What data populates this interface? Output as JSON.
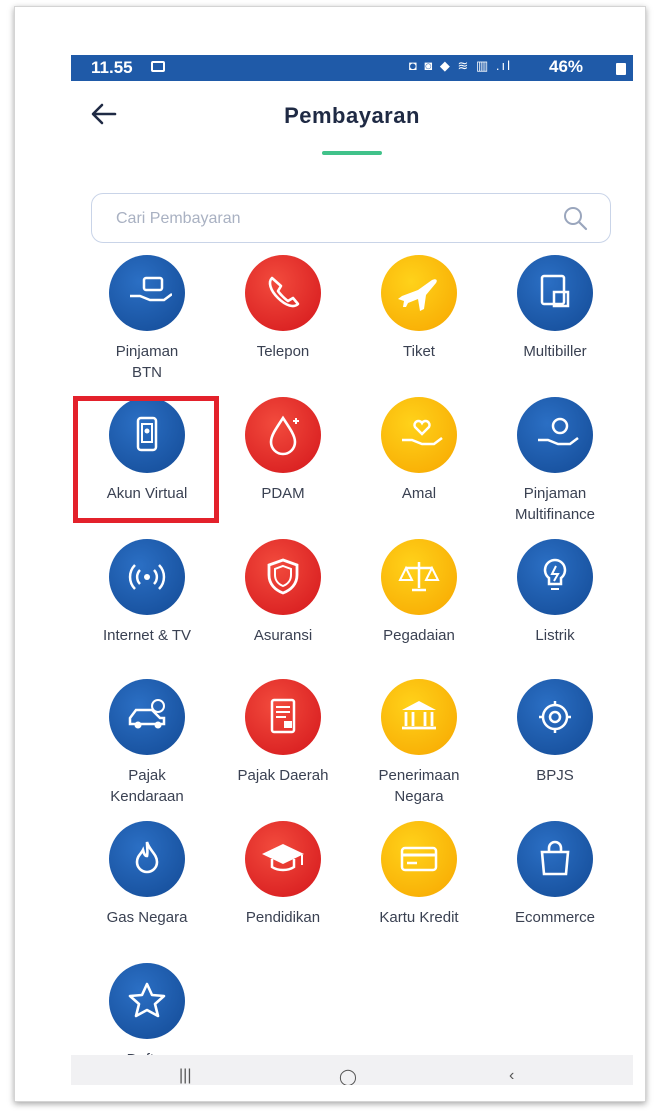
{
  "status_bar": {
    "time": "11.55",
    "icons_text": "◘ ◙ ◆ ≋ ▥ .ıl",
    "battery": "46%"
  },
  "header": {
    "title": "Pembayaran",
    "accent_color": "#41c28a"
  },
  "search": {
    "placeholder": "Cari Pembayaran"
  },
  "menu": [
    {
      "label": "Pinjaman\nBTN",
      "color": "blue",
      "icon": "hand-card-icon"
    },
    {
      "label": "Telepon",
      "color": "red",
      "icon": "phone-icon"
    },
    {
      "label": "Tiket",
      "color": "yellow",
      "icon": "airplane-icon"
    },
    {
      "label": "Multibiller",
      "color": "blue",
      "icon": "receipt-icon"
    },
    {
      "label": "Akun Virtual",
      "color": "blue",
      "icon": "mobile-account-icon"
    },
    {
      "label": "PDAM",
      "color": "red",
      "icon": "water-drop-icon"
    },
    {
      "label": "Amal",
      "color": "yellow",
      "icon": "hand-heart-icon"
    },
    {
      "label": "Pinjaman\nMultifinance",
      "color": "blue",
      "icon": "hand-coin-icon"
    },
    {
      "label": "Internet & TV",
      "color": "blue",
      "icon": "broadcast-icon"
    },
    {
      "label": "Asuransi",
      "color": "red",
      "icon": "shield-icon"
    },
    {
      "label": "Pegadaian",
      "color": "yellow",
      "icon": "scale-icon"
    },
    {
      "label": "Listrik",
      "color": "blue",
      "icon": "lightbulb-icon"
    },
    {
      "label": "Pajak\nKendaraan",
      "color": "blue",
      "icon": "car-icon"
    },
    {
      "label": "Pajak Daerah",
      "color": "red",
      "icon": "tax-document-icon"
    },
    {
      "label": "Penerimaan\nNegara",
      "color": "yellow",
      "icon": "government-building-icon"
    },
    {
      "label": "BPJS",
      "color": "blue",
      "icon": "bpjs-icon"
    },
    {
      "label": "Gas Negara",
      "color": "blue",
      "icon": "flame-icon"
    },
    {
      "label": "Pendidikan",
      "color": "red",
      "icon": "graduation-cap-icon"
    },
    {
      "label": "Kartu Kredit",
      "color": "yellow",
      "icon": "credit-card-icon"
    },
    {
      "label": "Ecommerce",
      "color": "blue",
      "icon": "shopping-bag-icon"
    },
    {
      "label": "Daftar\nPembayaran",
      "color": "blue",
      "icon": "star-icon"
    }
  ],
  "highlighted_item": "Akun Virtual",
  "highlight_color": "#e3212b",
  "colors": {
    "blue": "#1f5aa8",
    "red": "#e0241f",
    "yellow": "#fbbd0a"
  }
}
